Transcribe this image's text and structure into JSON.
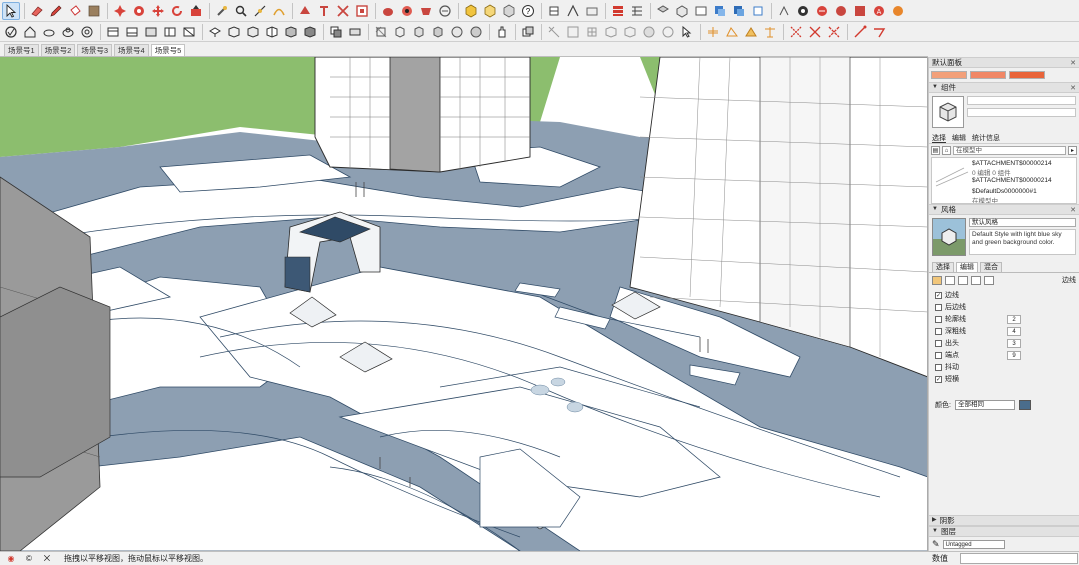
{
  "toolbar": {
    "row1_icons": [
      "select-arrow-icon",
      "eraser-icon",
      "pencil-icon",
      "paint-bucket-icon",
      "texture-icon",
      "red-tool-icon",
      "red-tool-2-icon",
      "move-icon",
      "rotate-icon",
      "push-pull-icon",
      "tape-measure-icon",
      "search-icon",
      "dimension-icon",
      "arc-icon",
      "protractor-icon",
      "text-icon",
      "axes-icon",
      "paint-red-icon",
      "sphere-red-icon",
      "heart-red-icon",
      "circle-tool-icon",
      "box-yellow-icon",
      "box-yellow-2-icon",
      "box-gray-icon",
      "help-icon",
      "component-icon",
      "flip-icon",
      "group-icon",
      "table-red-icon",
      "scale-icon",
      "camera-icon",
      "walk-icon",
      "look-around-icon",
      "section-icon",
      "layer-blue-icon",
      "layer-blue-2-icon",
      "layer-blue-3-icon",
      "tool-a-icon",
      "tool-b-icon",
      "fillet-red-icon",
      "chamfer-red-icon",
      "extrude-red-icon",
      "plugin-red-icon",
      "plugin-orange-icon"
    ],
    "row2_icons": [
      "select-circle-icon",
      "house-icon",
      "cloud-icon",
      "cloud-2-icon",
      "orbit-icon",
      "view-top-icon",
      "view-front-icon",
      "view-back-icon",
      "view-left-icon",
      "view-iso-icon",
      "shaded-icon",
      "wireframe-icon",
      "xray-icon",
      "hidden-line-icon",
      "textured-icon",
      "monochrome-icon",
      "shadow-icon",
      "fog-icon",
      "section-cut-icon",
      "box-3d-icon",
      "box-3d-2-icon",
      "box-3d-3-icon",
      "sphere-icon",
      "sphere-2-icon",
      "hand-icon",
      "snap-icon",
      "ruler-icon",
      "angle-icon",
      "protractor-2-icon",
      "curve-icon",
      "dome-icon",
      "circle-icon",
      "arrow-icon",
      "cursor-icon",
      "move-cross-icon",
      "rotate-2-icon",
      "scale-2-icon",
      "help-2-icon",
      "x-red-icon",
      "x-red-2-icon",
      "x-red-3-icon",
      "line-red-icon",
      "line-red-2-icon"
    ]
  },
  "scenes": [
    {
      "label": "场景号1"
    },
    {
      "label": "场景号2"
    },
    {
      "label": "场景号3"
    },
    {
      "label": "场景号4"
    },
    {
      "label": "场景号5"
    }
  ],
  "tray": {
    "default_panel": {
      "title": "默认面板"
    },
    "swatch_colors": [
      "#f2a07a",
      "#f08766",
      "#e8643a"
    ],
    "entity_info": {
      "title": "组件"
    },
    "components": {
      "tabs": [
        "选择",
        "编辑",
        "统计信息"
      ],
      "search_value": "在模型中",
      "items": [
        {
          "name": "$ATTACHMENT$00000214",
          "sub": "0 编辑 0 组件"
        },
        {
          "name": "$ATTACHMENT$00000214",
          "sub": ""
        },
        {
          "name": "$DefaultDs0000000#1",
          "sub": "在模型中"
        }
      ]
    },
    "styles": {
      "title": "风格",
      "style_name": "默认风格",
      "description": "Default Style with light blue sky and green background color.",
      "tabs": [
        "选择",
        "编辑",
        "混合"
      ],
      "edit_label": "边线",
      "options": [
        {
          "label": "边线",
          "checked": true,
          "value": ""
        },
        {
          "label": "后边线",
          "checked": false,
          "value": ""
        },
        {
          "label": "轮廓线",
          "checked": false,
          "value": "2"
        },
        {
          "label": "深粗线",
          "checked": false,
          "value": "4"
        },
        {
          "label": "出头",
          "checked": false,
          "value": "3"
        },
        {
          "label": "端点",
          "checked": false,
          "value": "9"
        },
        {
          "label": "抖动",
          "checked": false,
          "value": ""
        },
        {
          "label": "短横",
          "checked": true,
          "value": ""
        }
      ],
      "color_label": "颜色:",
      "color_value": "全部相同",
      "edge_color": "#4a6d8c"
    },
    "panels_bottom": [
      {
        "title": "阴影"
      },
      {
        "title": "图层"
      }
    ],
    "tag_select": "Untagged"
  },
  "status": {
    "message": "拖拽以平移视图，拖动鼠标以平移视图。",
    "measurements_label": "数值"
  }
}
